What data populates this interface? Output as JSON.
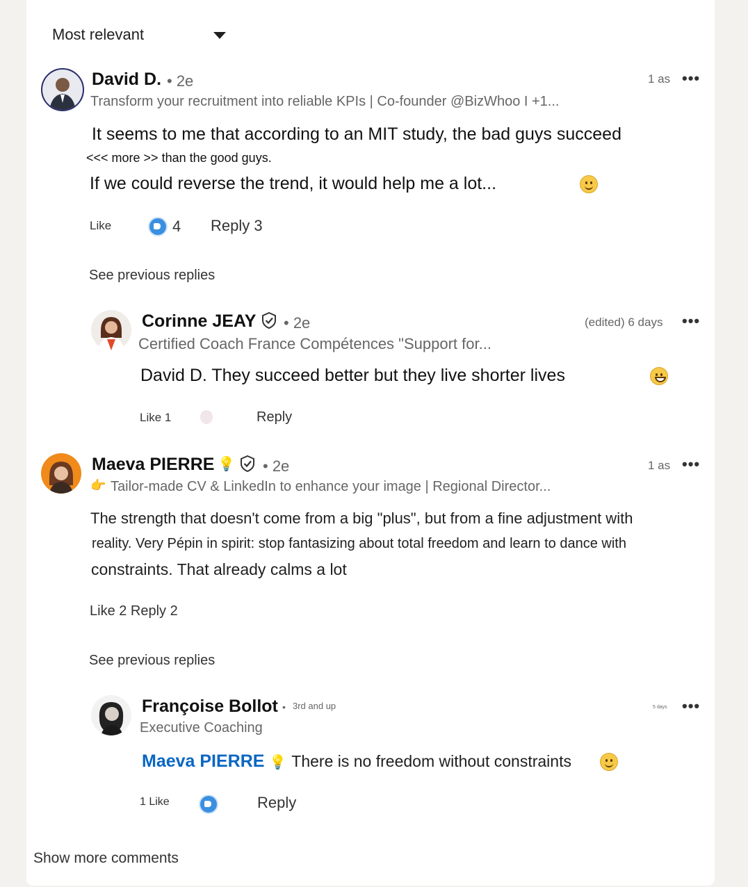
{
  "sort": {
    "label": "Most relevant"
  },
  "comments": [
    {
      "name": "David D.",
      "degree": "• 2e",
      "headline": "Transform your recruitment into reliable KPIs | Co-founder @BizWhoo I +1...",
      "time": "1 as",
      "body_line1": "It seems to me that according to an MIT study, the bad guys succeed",
      "body_line2": "<<< more >> than the good guys.",
      "body_line3": "If we could reverse the trend, it would help me a lot...",
      "like_label": "Like",
      "reaction_count": "4",
      "reply_label": "Reply 3",
      "see_previous": "See previous replies"
    },
    {
      "name": "Corinne JEAY",
      "degree": "• 2e",
      "headline": "Certified Coach France Compétences \"Support for...",
      "time": "(edited) 6 days",
      "body": "David D. They succeed better but they live shorter lives",
      "like_label": "Like 1",
      "reply_label": "Reply"
    },
    {
      "name": "Maeva PIERRE",
      "degree": "• 2e",
      "headline": "Tailor-made CV & LinkedIn to enhance your image | Regional Director...",
      "time": "1 as",
      "body_line1": "The strength that doesn't come from a big \"plus\", but from a fine adjustment with",
      "body_line2": "reality. Very Pépin in spirit: stop fantasizing about total freedom and learn to dance with",
      "body_line3": "constraints. That already calms a lot",
      "actions": "Like 2 Reply 2",
      "see_previous": "See previous replies"
    },
    {
      "name": "Françoise Bollot",
      "degree": "3rd and up",
      "headline": "Executive Coaching",
      "time": "5 days",
      "mention": "Maeva PIERRE",
      "body": "There is no freedom without constraints",
      "like_label": "1 Like",
      "reply_label": "Reply"
    }
  ],
  "more_dots": "•••",
  "show_more": "Show more comments"
}
